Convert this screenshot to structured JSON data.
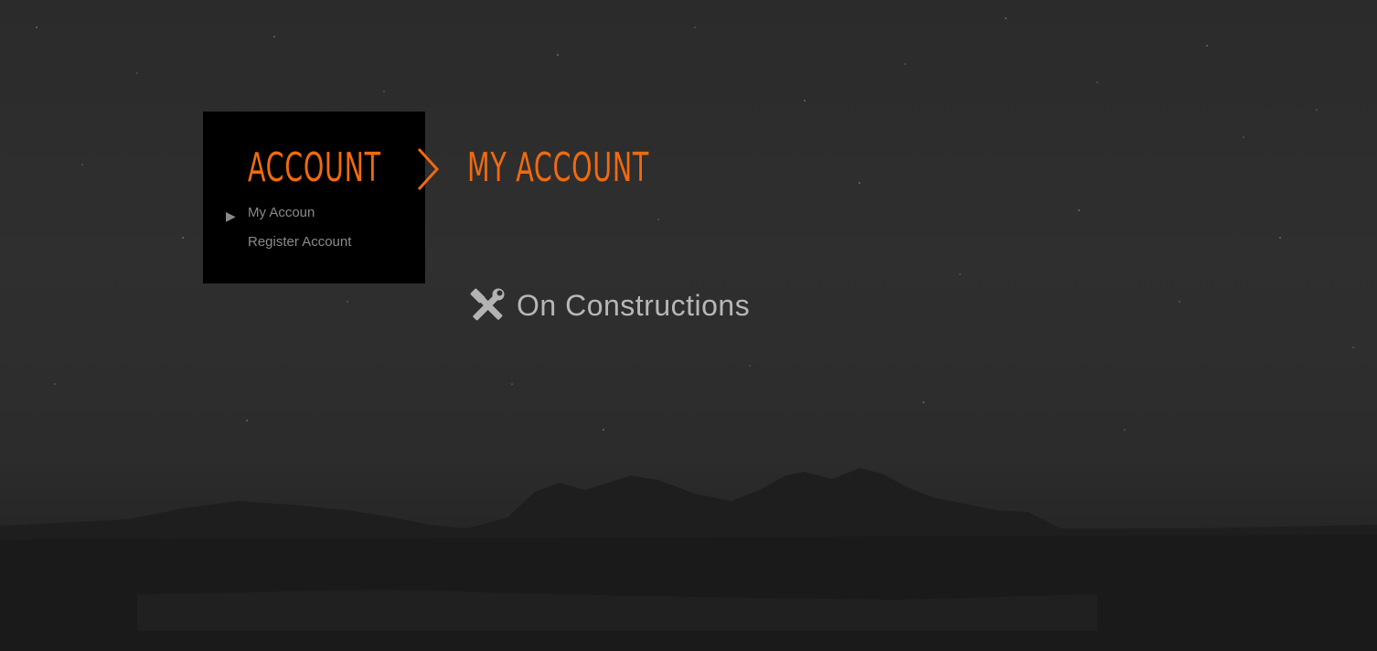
{
  "sidebar": {
    "title": "ACCOUNT",
    "items": [
      {
        "label": "My Accoun",
        "active": true
      },
      {
        "label": "Register Account",
        "active": false
      }
    ]
  },
  "breadcrumb": {
    "separator_icon": "chevron-right-icon",
    "current": "MY ACCOUNT"
  },
  "notice": {
    "icon": "tools-icon",
    "text": "On Constructions"
  },
  "colors": {
    "accent": "#f06a0f",
    "panel": "#000000",
    "muted_text": "#8a8a8a",
    "notice_text": "#b7b7b7"
  }
}
